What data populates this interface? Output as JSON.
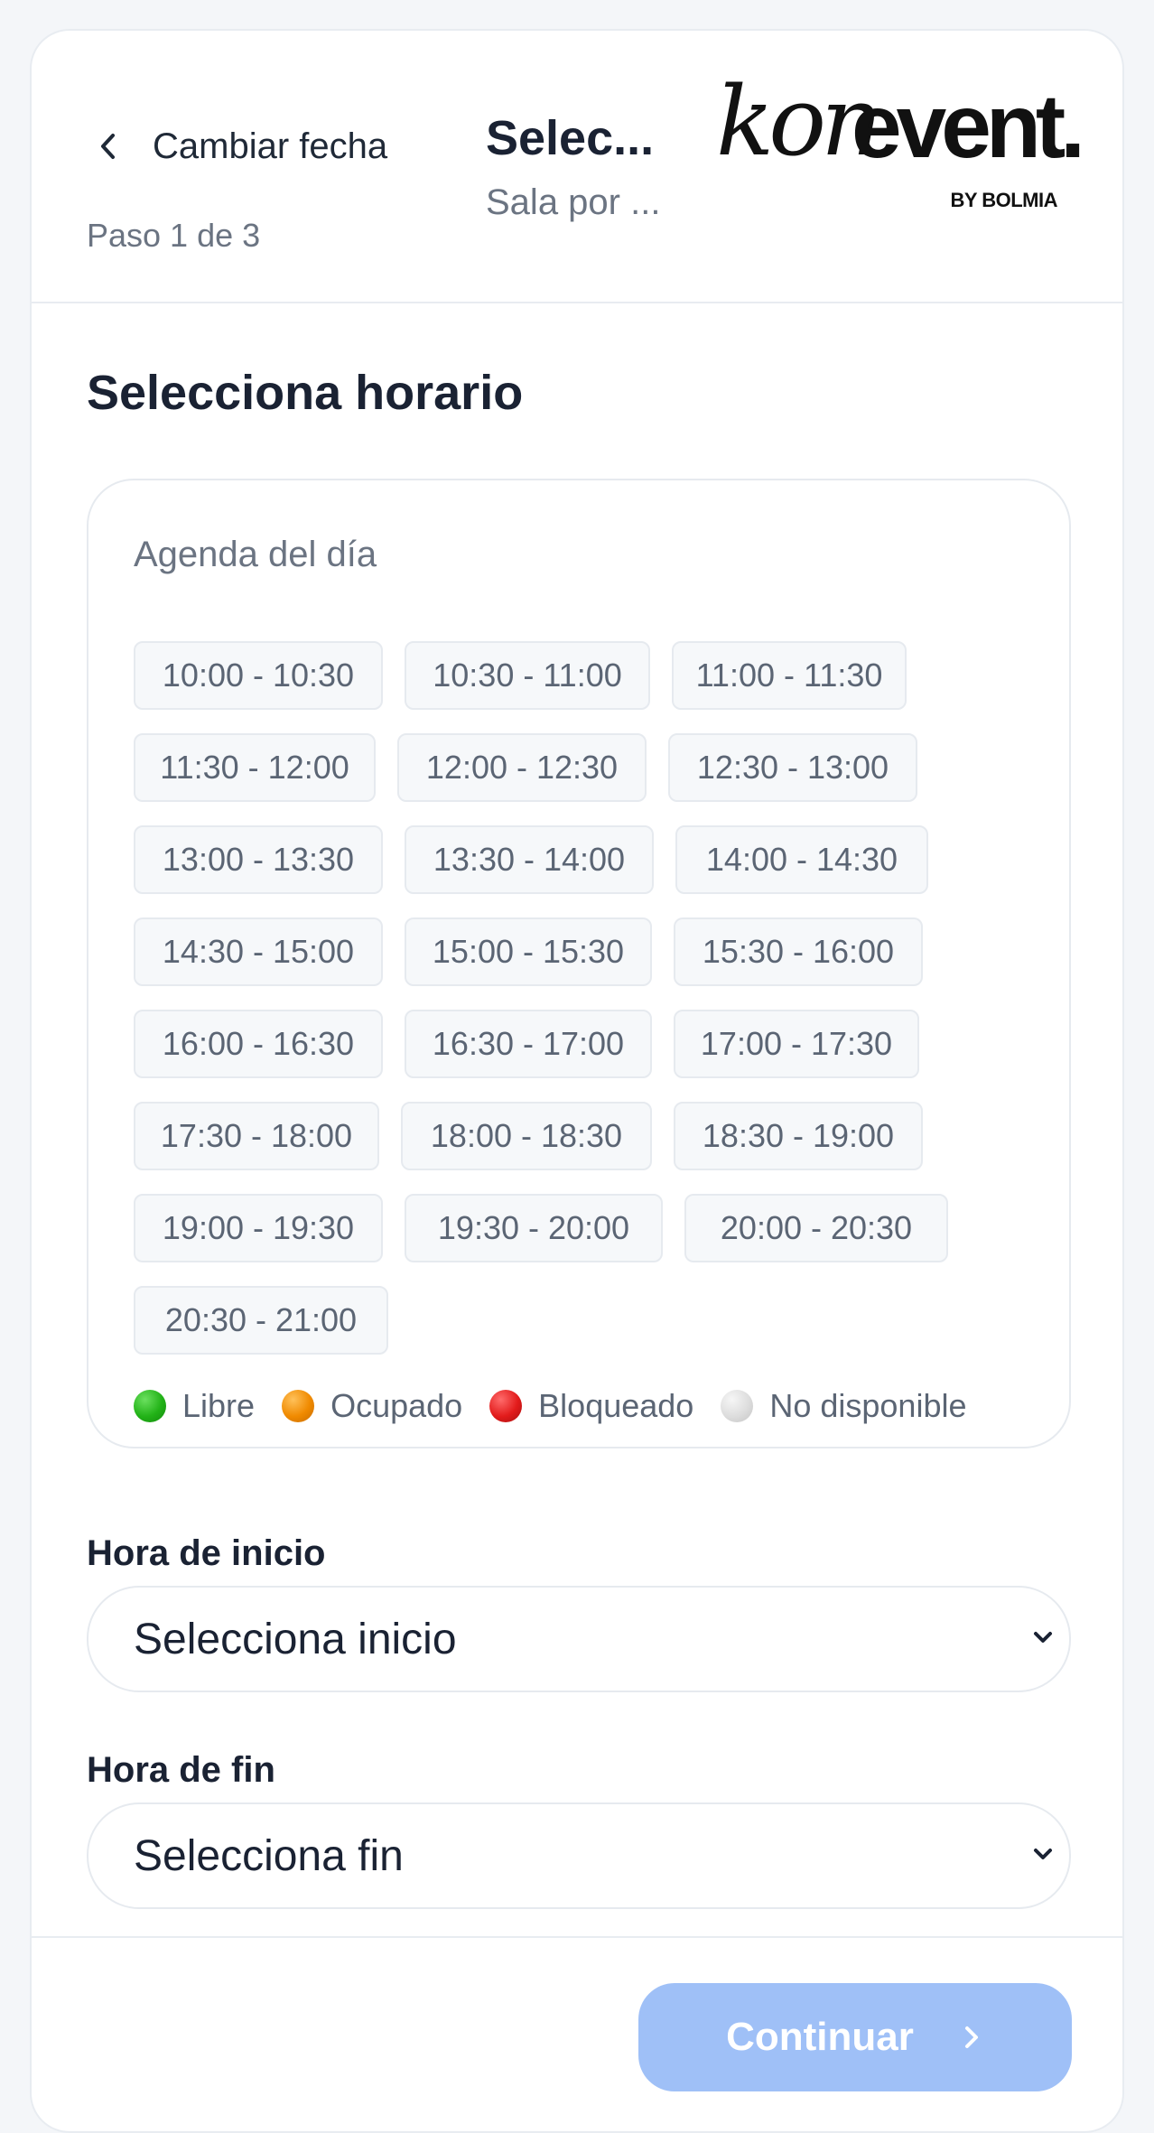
{
  "header": {
    "back_label": "Cambiar fecha",
    "title": "Selec...",
    "subtitle": "Sala por ...",
    "step": "Paso 1 de 3",
    "logo": {
      "kon": "kon",
      "event": "event.",
      "by": "BY BOLMIA"
    }
  },
  "main": {
    "section_title": "Selecciona horario",
    "agenda": {
      "title": "Agenda del día",
      "slots": [
        "10:00 - 10:30",
        "10:30 - 11:00",
        "11:00 - 11:30",
        "11:30 - 12:00",
        "12:00 - 12:30",
        "12:30 - 13:00",
        "13:00 - 13:30",
        "13:30 - 14:00",
        "14:00 - 14:30",
        "14:30 - 15:00",
        "15:00 - 15:30",
        "15:30 - 16:00",
        "16:00 - 16:30",
        "16:30 - 17:00",
        "17:00 - 17:30",
        "17:30 - 18:00",
        "18:00 - 18:30",
        "18:30 - 19:00",
        "19:00 - 19:30",
        "19:30 - 20:00",
        "20:00 - 20:30",
        "20:30 - 21:00"
      ],
      "legend": [
        {
          "label": "Libre",
          "color": "#22b217"
        },
        {
          "label": "Ocupado",
          "color": "#f08a00"
        },
        {
          "label": "Bloqueado",
          "color": "#e21b1b"
        },
        {
          "label": "No disponible",
          "color": "#dddddd"
        }
      ]
    },
    "start": {
      "label": "Hora de inicio",
      "value": "Selecciona inicio"
    },
    "end": {
      "label": "Hora de fin",
      "value": "Selecciona fin"
    }
  },
  "footer": {
    "continue_label": "Continuar",
    "button_color": "#9fc0f7"
  }
}
